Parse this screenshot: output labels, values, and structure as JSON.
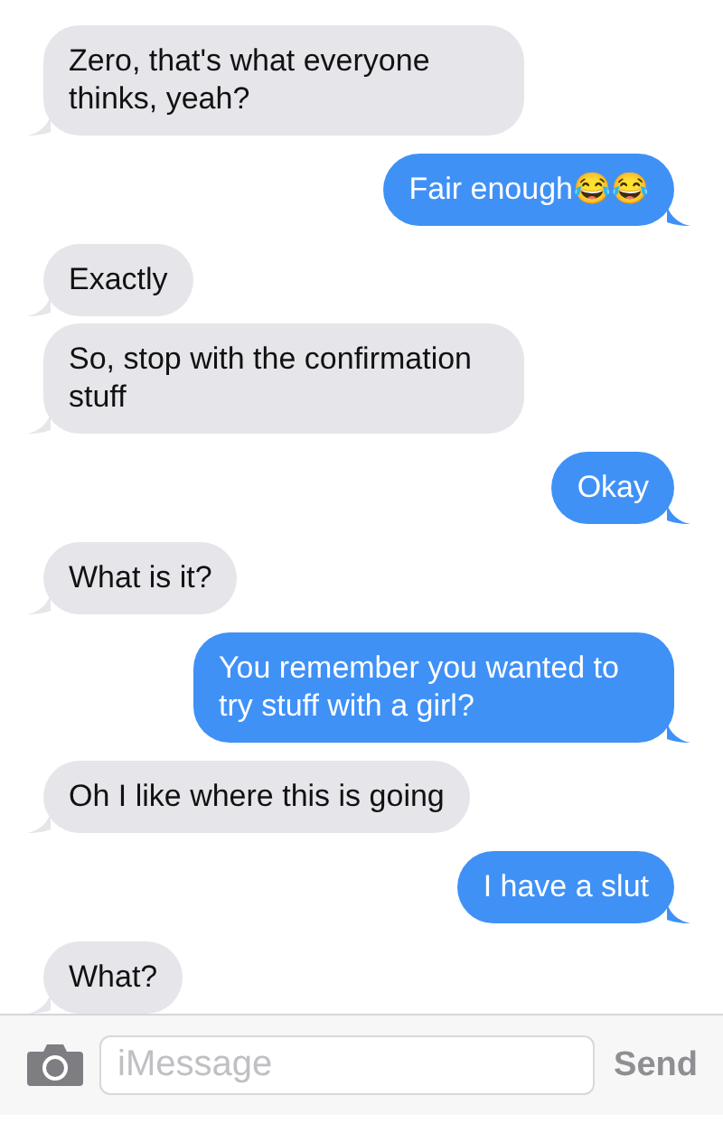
{
  "messages": [
    {
      "kind": "received",
      "text": "Zero, that's what everyone thinks, yeah?"
    },
    {
      "kind": "sent",
      "text": "Fair enough😂😂"
    },
    {
      "kind": "received",
      "text": "Exactly"
    },
    {
      "kind": "received",
      "text": "So, stop with the confirmation stuff"
    },
    {
      "kind": "sent",
      "text": "Okay"
    },
    {
      "kind": "received",
      "text": "What is it?"
    },
    {
      "kind": "sent",
      "text": "You remember you wanted to try stuff with a girl?"
    },
    {
      "kind": "received",
      "text": "Oh I like where this is going"
    },
    {
      "kind": "sent",
      "text": "I have a slut"
    },
    {
      "kind": "received",
      "text": "What?"
    }
  ],
  "composer": {
    "placeholder": "iMessage",
    "send_label": "Send"
  }
}
